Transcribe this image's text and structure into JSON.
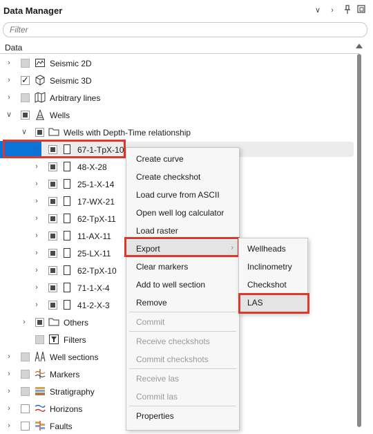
{
  "panel": {
    "title": "Data Manager"
  },
  "filter": {
    "placeholder": "Filter"
  },
  "column": {
    "header": "Data"
  },
  "tree": {
    "seismic2d": "Seismic 2D",
    "seismic3d": "Seismic 3D",
    "arbitrary": "Arbitrary lines",
    "wells": "Wells",
    "wells_dt": "Wells with Depth-Time relationship",
    "well_items": [
      "67-1-TpX-10",
      "48-X-28",
      "25-1-X-14",
      "17-WX-21",
      "62-TpX-11",
      "11-AX-11",
      "25-LX-11",
      "62-TpX-10",
      "71-1-X-4",
      "41-2-X-3"
    ],
    "others": "Others",
    "filters": "Filters",
    "well_sections": "Well sections",
    "markers": "Markers",
    "stratigraphy": "Stratigraphy",
    "horizons": "Horizons",
    "faults": "Faults"
  },
  "context_menu": {
    "items": [
      "Create curve",
      "Create checkshot",
      "Load curve from ASCII",
      "Open well log calculator",
      "Load raster",
      "Export",
      "Clear markers",
      "Add to well section",
      "Remove",
      "Commit",
      "Receive checkshots",
      "Commit checkshots",
      "Receive las",
      "Commit las",
      "Properties"
    ]
  },
  "export_submenu": {
    "items": [
      "Wellheads",
      "Inclinometry",
      "Checkshot",
      "LAS"
    ]
  },
  "colors": {
    "selection": "#0b74d9",
    "highlight_box": "#d93a2b"
  },
  "icons": {
    "collapse": "chevron-down-icon",
    "pin": "pin-icon",
    "float": "float-window-icon",
    "expand": "chevron-right-icon"
  }
}
